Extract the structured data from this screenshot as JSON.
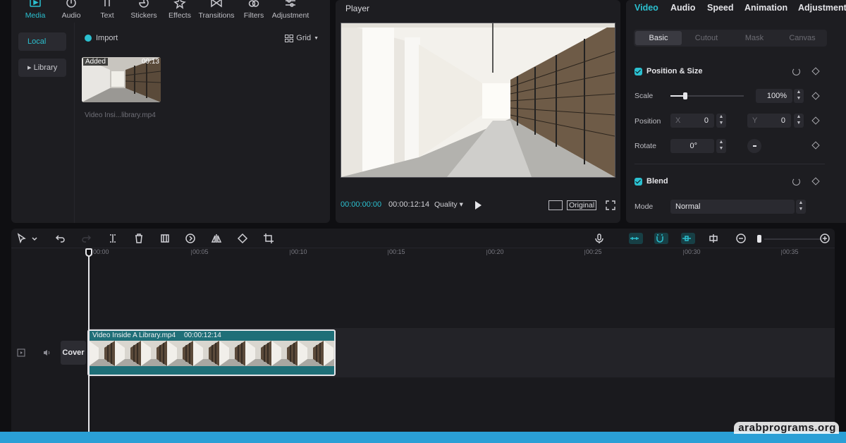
{
  "media_tabs": [
    {
      "label": "Media",
      "icon": "media-icon",
      "active": true
    },
    {
      "label": "Audio",
      "icon": "audio-icon"
    },
    {
      "label": "Text",
      "icon": "text-icon"
    },
    {
      "label": "Stickers",
      "icon": "sticker-icon"
    },
    {
      "label": "Effects",
      "icon": "effects-icon"
    },
    {
      "label": "Transitions",
      "icon": "transition-icon"
    },
    {
      "label": "Filters",
      "icon": "filter-icon"
    },
    {
      "label": "Adjustment",
      "icon": "adjustment-icon"
    }
  ],
  "media_side": {
    "local": "Local",
    "library": "▸ Library"
  },
  "media_toolbar": {
    "import": "Import",
    "view": "Grid"
  },
  "media_item": {
    "badge": "Added",
    "duration": "00:13",
    "name": "Video Insi...library.mp4"
  },
  "player": {
    "title": "Player",
    "current_time": "00:00:00:00",
    "total_time": "00:00:12:14",
    "quality": "Quality",
    "ratio": "Original"
  },
  "props": {
    "tabs": [
      "Video",
      "Audio",
      "Speed",
      "Animation",
      "Adjustment"
    ],
    "subtabs": [
      "Basic",
      "Cutout",
      "Mask",
      "Canvas"
    ],
    "position_size": {
      "title": "Position & Size",
      "scale_label": "Scale",
      "scale_value": "100%",
      "scale_fraction": 0.2,
      "position_label": "Position",
      "x_label": "X",
      "x_value": "0",
      "y_label": "Y",
      "y_value": "0",
      "rotate_label": "Rotate",
      "rotate_value": "0°"
    },
    "blend": {
      "title": "Blend",
      "mode_label": "Mode",
      "mode_value": "Normal"
    }
  },
  "timeline": {
    "ruler": [
      "00:00",
      "00:05",
      "00:10",
      "00:15",
      "00:20",
      "00:25",
      "00:30",
      "00:35"
    ],
    "cover_label": "Cover",
    "clip_name": "Video Inside A Library.mp4",
    "clip_duration": "00:00:12:14",
    "zoom_fraction": 0.05
  },
  "accent_color": "#2bc0d0",
  "watermark": "arabprograms.org"
}
